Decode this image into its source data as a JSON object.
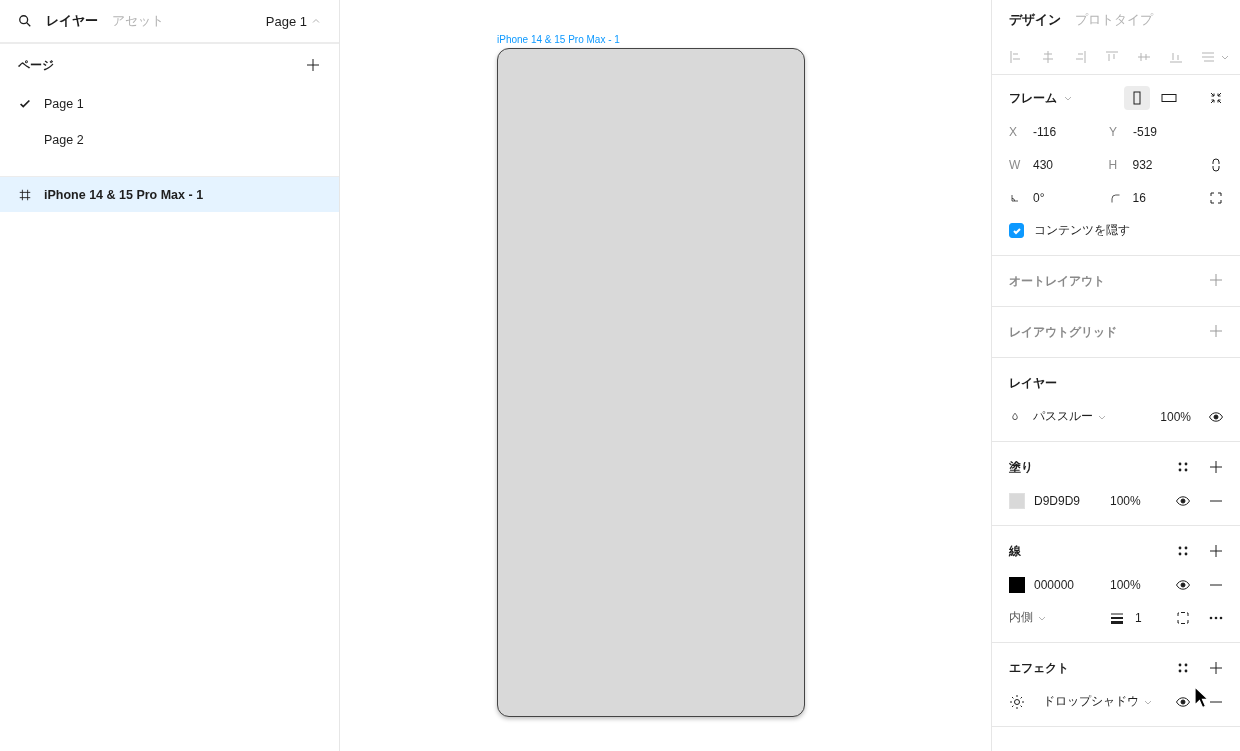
{
  "left_panel": {
    "tabs": [
      {
        "label": "レイヤー",
        "selected": true
      },
      {
        "label": "アセット",
        "selected": false
      }
    ],
    "page_switcher": "Page 1",
    "pages_heading": "ページ",
    "pages": [
      {
        "label": "Page 1",
        "selected": true
      },
      {
        "label": "Page 2",
        "selected": false
      }
    ],
    "layers": [
      {
        "label": "iPhone 14 & 15 Pro Max - 1",
        "selected": true
      }
    ]
  },
  "canvas": {
    "frame_label": "iPhone 14 & 15 Pro Max - 1"
  },
  "right_panel": {
    "tabs": [
      {
        "label": "デザイン",
        "selected": true
      },
      {
        "label": "プロトタイプ",
        "selected": false
      }
    ],
    "frame": {
      "title": "フレーム",
      "orientations": [
        {
          "kind": "portrait",
          "selected": true
        },
        {
          "kind": "landscape",
          "selected": false
        }
      ],
      "rows": [
        {
          "fields": [
            {
              "kind": "text",
              "label": "X",
              "value": "-116"
            },
            {
              "kind": "text",
              "label": "Y",
              "value": "-519"
            }
          ]
        },
        {
          "fields": [
            {
              "kind": "text",
              "label": "W",
              "value": "430"
            },
            {
              "kind": "text",
              "label": "H",
              "value": "932"
            }
          ]
        },
        {
          "fields": [
            {
              "kind": "rotation",
              "value": "0°"
            },
            {
              "kind": "radius",
              "value": "16"
            }
          ]
        }
      ],
      "clip_content": {
        "label": "コンテンツを隠す",
        "checked": true
      }
    },
    "empty_sections": [
      {
        "title": "オートレイアウト"
      },
      {
        "title": "レイアウトグリッド"
      }
    ],
    "layer": {
      "title": "レイヤー",
      "blend_mode": "パススルー",
      "opacity": "100%"
    },
    "fill": {
      "title": "塗り",
      "items": [
        {
          "color": "#d9d9d9",
          "hex": "D9D9D9",
          "opacity": "100%"
        }
      ]
    },
    "stroke": {
      "title": "線",
      "items": [
        {
          "color": "#000000",
          "hex": "000000",
          "opacity": "100%"
        }
      ],
      "position": "内側",
      "weight": "1"
    },
    "effects": {
      "title": "エフェクト",
      "items": [
        {
          "name": "ドロップシャドウ"
        }
      ]
    }
  }
}
